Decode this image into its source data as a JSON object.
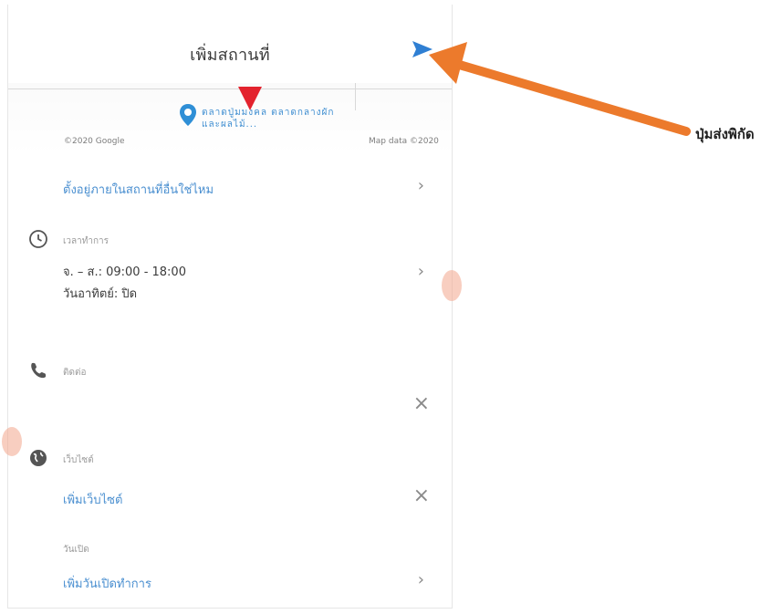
{
  "header": {
    "title": "เพิ่มสถานที่",
    "send_icon": "send-arrow-icon"
  },
  "map": {
    "place_name": "ตลาดปู่มมงคล ตลาดกลางผักและผลไม้...",
    "credit_left": "©2020 Google",
    "credit_right": "Map data ©2020"
  },
  "rows": {
    "move_location": "ตั้งอยู่ภายในสถานที่อื่นใช่ไหม",
    "hours_label": "เวลาทำการ",
    "hours_line1": "จ. – ส.: 09:00 - 18:00",
    "hours_line2": "วันอาทิตย์: ปิด",
    "phone_label": "ติดต่อ",
    "website_label": "เว็บไซต์",
    "website_link": "เพิ่มเว็บไซต์",
    "open_date_label": "วันเปิด",
    "open_date_link": "เพิ่มวันเปิดทำการ"
  },
  "annotation": {
    "label": "ปุ่มส่งพิกัด"
  },
  "colors": {
    "accent_blue": "#2f7fd3",
    "arrow_orange": "#ec7a2c",
    "marker_red": "#e3232e"
  }
}
